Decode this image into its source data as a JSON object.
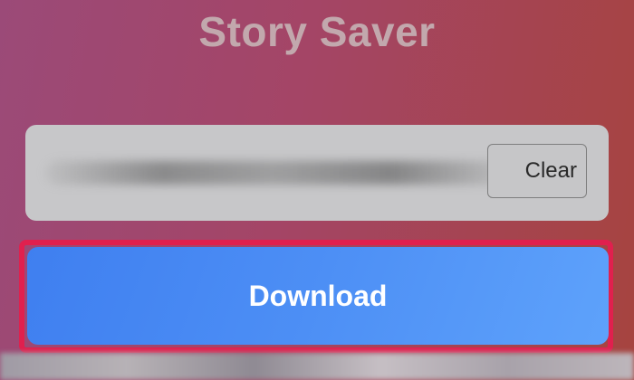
{
  "app": {
    "title": "Story Saver"
  },
  "input": {
    "clear_label": "Clear"
  },
  "actions": {
    "download_label": "Download"
  }
}
